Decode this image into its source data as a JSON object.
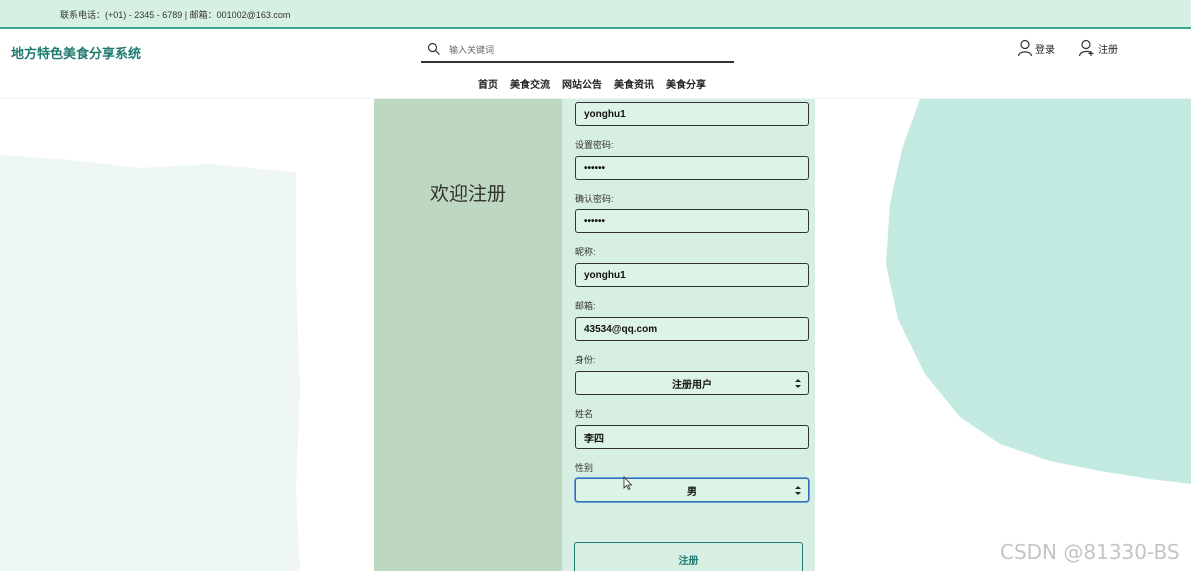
{
  "topbar": {
    "contact_text": "联系电话：(+01) - 2345 - 6789 | 邮箱：001002@163.com"
  },
  "header": {
    "site_title": "地方特色美食分享系统",
    "search_placeholder": "输入关键词",
    "login_label": "登录",
    "register_label": "注册",
    "nav": [
      "首页",
      "美食交流",
      "网站公告",
      "美食资讯",
      "美食分享"
    ]
  },
  "form": {
    "welcome": "欢迎注册",
    "username_value": "yonghu1",
    "password_label": "设置密码:",
    "password_value": "••••••",
    "confirm_label": "确认密码:",
    "confirm_value": "••••••",
    "nickname_label": "昵称:",
    "nickname_value": "yonghu1",
    "email_label": "邮箱:",
    "email_value": "43534@qq.com",
    "identity_label": "身份:",
    "identity_value": "注册用户",
    "name_label": "姓名",
    "name_value": "李四",
    "gender_label": "性别",
    "gender_value": "男",
    "submit_label": "注册"
  },
  "watermark": "CSDN @81330-BS",
  "colors": {
    "accent": "#1f7a70",
    "topbar_bg": "#d7f0e4",
    "panel_left_bg": "#bed7c0",
    "panel_right_bg": "#d6efe2",
    "blob": "#c3eae0"
  }
}
